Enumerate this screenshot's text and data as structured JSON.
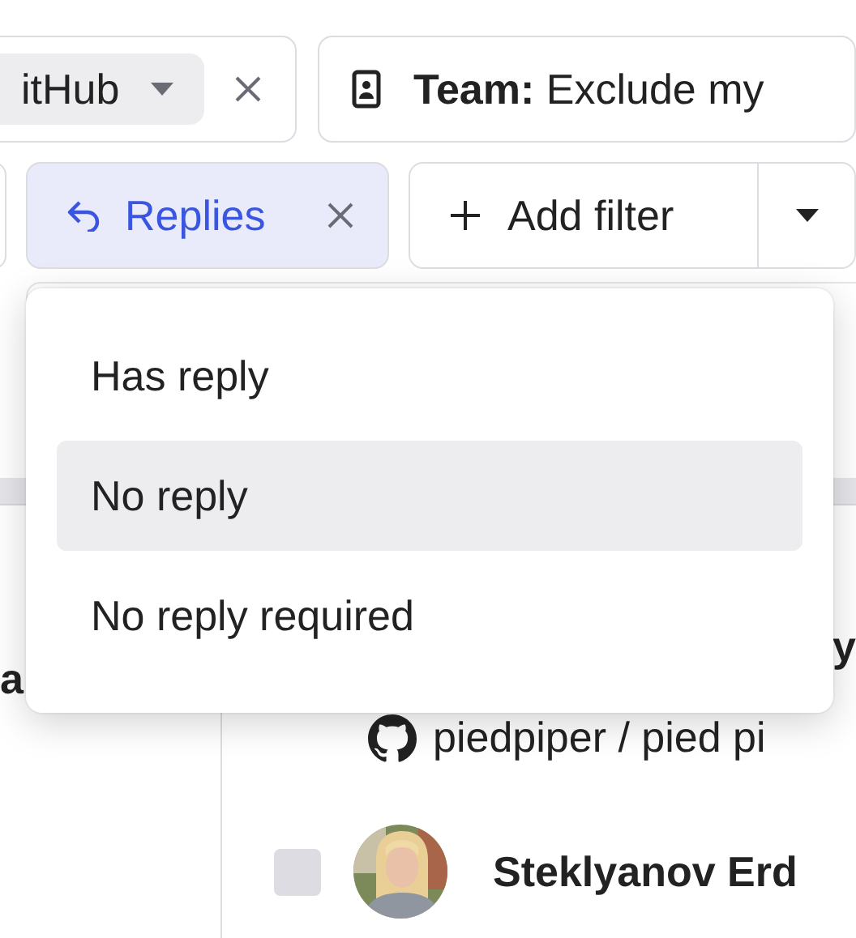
{
  "filter_bar": {
    "source_chip": {
      "value": "itHub"
    },
    "team_chip": {
      "label": "**Team:** Exclude my"
    },
    "replies_chip": {
      "label": "Replies",
      "active": true
    },
    "add_filter": {
      "label": "Add filter"
    }
  },
  "dropdown": {
    "options": [
      {
        "label": "Has reply",
        "selected": false
      },
      {
        "label": "No reply",
        "selected": true
      },
      {
        "label": "No reply required",
        "selected": false
      }
    ]
  },
  "background": {
    "left_fragment": "a",
    "right_fragment": "y",
    "repo": "piedpiper / pied pi",
    "author": {
      "name": "Steklyanov Erd",
      "checked": false
    }
  }
}
